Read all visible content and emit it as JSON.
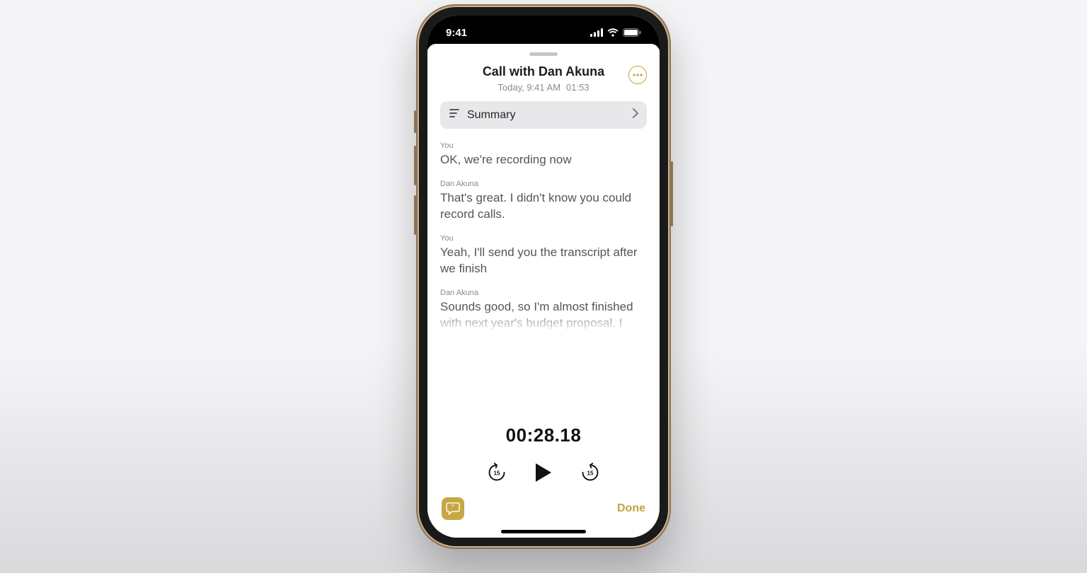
{
  "statusbar": {
    "time": "9:41"
  },
  "header": {
    "title": "Call with Dan Akuna",
    "date": "Today, 9:41 AM",
    "duration": "01:53"
  },
  "summary": {
    "label": "Summary"
  },
  "transcript": [
    {
      "speaker": "You",
      "text": "OK, we're recording now"
    },
    {
      "speaker": "Dan Akuna",
      "text": "That's great. I didn't know you could record calls."
    },
    {
      "speaker": "You",
      "text": "Yeah, I'll send you the transcript after we finish"
    },
    {
      "speaker": "Dan Akuna",
      "text": "Sounds good, so I'm almost finished with next year's budget proposal. I"
    }
  ],
  "player": {
    "timecode": "00:28.18",
    "skip_seconds": "15"
  },
  "bottombar": {
    "done": "Done"
  }
}
